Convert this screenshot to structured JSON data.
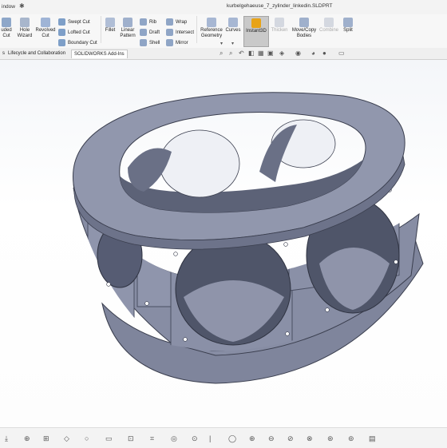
{
  "titlebar": {
    "menu_label": "indow",
    "document_title": "kurbelgehaeuse_7_zylinder_linkedin.SLDPRT"
  },
  "ribbon": {
    "buttons_large": [
      {
        "label": "uded\nCut",
        "icon": "extruded-cut-icon"
      },
      {
        "label": "Hole\nWizard",
        "icon": "hole-wizard-icon"
      },
      {
        "label": "Revolved\nCut",
        "icon": "revolved-cut-icon"
      },
      {
        "label": "Fillet",
        "icon": "fillet-icon"
      },
      {
        "label": "Linear\nPattern",
        "icon": "linear-pattern-icon"
      },
      {
        "label": "Reference\nGeometry",
        "icon": "reference-geometry-icon"
      },
      {
        "label": "Curves",
        "icon": "curves-icon"
      },
      {
        "label": "Instant3D",
        "icon": "instant3d-icon"
      },
      {
        "label": "Thicken",
        "icon": "thicken-icon"
      },
      {
        "label": "Move/Copy\nBodies",
        "icon": "move-copy-bodies-icon"
      },
      {
        "label": "Combine",
        "icon": "combine-icon"
      },
      {
        "label": "Split",
        "icon": "split-icon"
      }
    ],
    "buttons_small": [
      {
        "label": "Swept Cut",
        "icon": "swept-cut-icon"
      },
      {
        "label": "Lofted Cut",
        "icon": "lofted-cut-icon"
      },
      {
        "label": "Boundary Cut",
        "icon": "boundary-cut-icon"
      },
      {
        "label": "Rib",
        "icon": "rib-icon"
      },
      {
        "label": "Draft",
        "icon": "draft-icon"
      },
      {
        "label": "Shell",
        "icon": "shell-icon"
      },
      {
        "label": "Wrap",
        "icon": "wrap-icon"
      },
      {
        "label": "Intersect",
        "icon": "intersect-icon"
      },
      {
        "label": "Mirror",
        "icon": "mirror-icon"
      }
    ]
  },
  "tabs": [
    {
      "label": "s"
    },
    {
      "label": "Lifecycle and Collaboration"
    },
    {
      "label": "SOLIDWORKS Add-Ins"
    }
  ],
  "colors": {
    "model_face": "#878da4",
    "model_shadow": "#565c73",
    "model_highlight": "#b9bfd0",
    "viewport_top": "#f4f6f9",
    "accent": "#e8a317"
  },
  "status_icons": [
    "status-icon",
    "status-icon",
    "status-icon",
    "status-icon",
    "status-icon",
    "status-icon",
    "status-icon",
    "status-icon",
    "status-icon",
    "status-icon",
    "status-icon"
  ]
}
